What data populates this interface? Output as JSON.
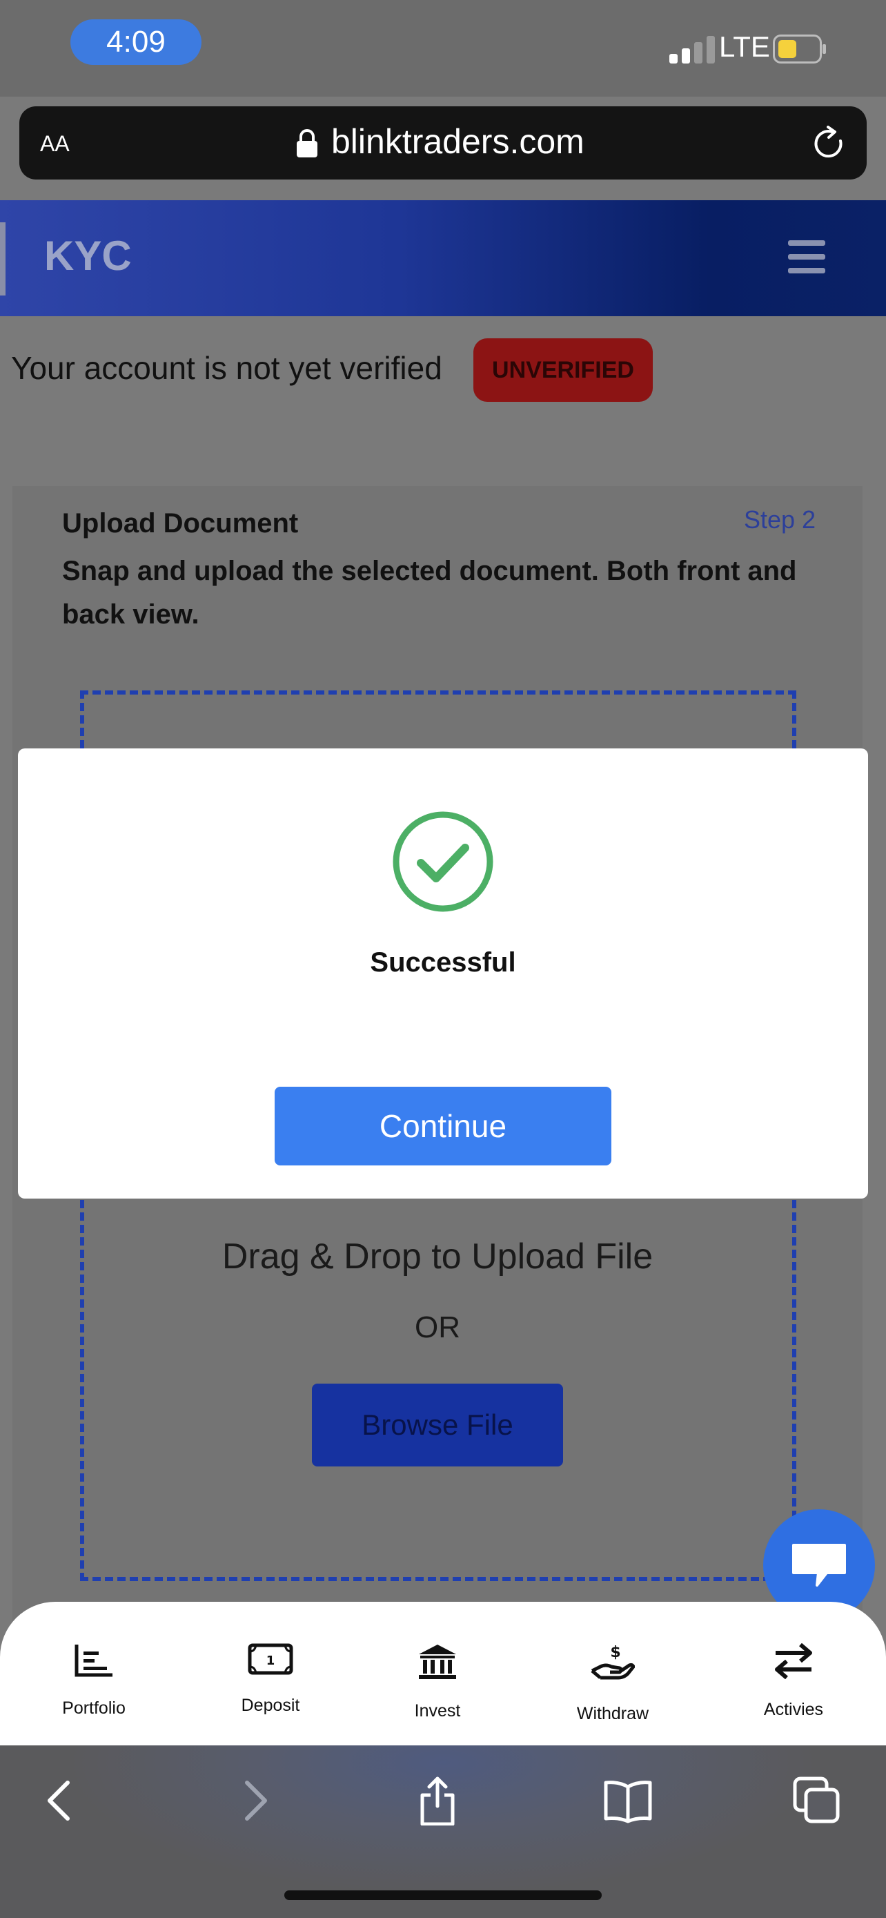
{
  "status_bar": {
    "time": "4:09",
    "network": "LTE"
  },
  "browser": {
    "text_size_label": "AA",
    "domain": "blinktraders.com"
  },
  "header": {
    "title": "KYC"
  },
  "account": {
    "message": "Your account is not yet verified",
    "status_badge": "UNVERIFIED"
  },
  "upload_card": {
    "title": "Upload Document",
    "step": "Step 2",
    "description": "Snap and upload the selected document. Both front and back view.",
    "dropzone_text": "Drag & Drop to Upload File",
    "or_text": "OR",
    "browse_label": "Browse File"
  },
  "modal": {
    "message": "Successful",
    "continue_label": "Continue"
  },
  "bottom_nav": {
    "items": [
      {
        "label": "Portfolio",
        "icon": "chart-icon"
      },
      {
        "label": "Deposit",
        "icon": "banknote-icon"
      },
      {
        "label": "Invest",
        "icon": "bank-icon"
      },
      {
        "label": "Withdraw",
        "icon": "hand-dollar-icon"
      },
      {
        "label": "Activies",
        "icon": "transfer-arrows-icon"
      }
    ]
  },
  "colors": {
    "header_start": "#2f45a8",
    "header_end": "#081e63",
    "badge": "#8c1414",
    "success_green": "#4caf65",
    "primary_button": "#3a7ff0",
    "chat_bubble": "#2f6fe2"
  }
}
